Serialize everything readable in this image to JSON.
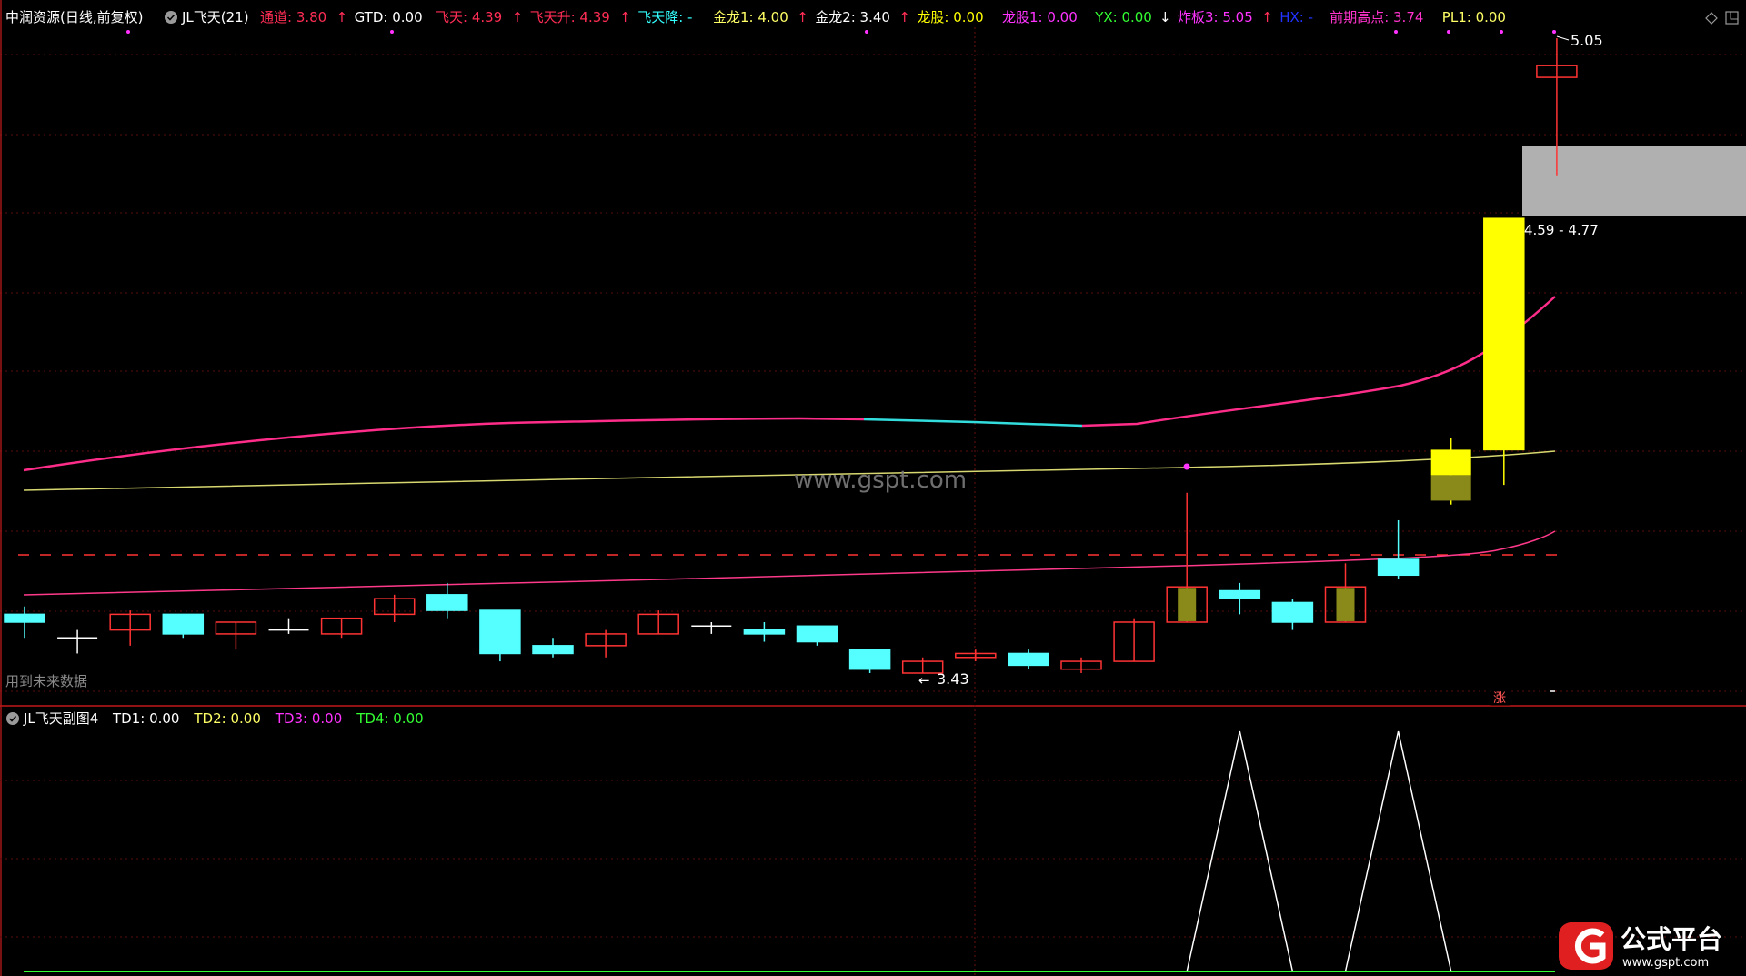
{
  "window": {
    "title": "中润资源(日线,前复权)",
    "indicator_name": "JL飞天(21)"
  },
  "main_legend": [
    {
      "label": "通道",
      "value": "3.80",
      "arrow": "up",
      "color": "#ff2d55"
    },
    {
      "label": "GTD",
      "value": "0.00",
      "arrow": "",
      "color": "#ffffff"
    },
    {
      "label": "飞天",
      "value": "4.39",
      "arrow": "up",
      "color": "#ff2d55"
    },
    {
      "label": "飞天升",
      "value": "4.39",
      "arrow": "up",
      "color": "#ff2d55"
    },
    {
      "label": "飞天降",
      "value": "-",
      "arrow": "",
      "color": "#33ffff"
    },
    {
      "label": "金龙1",
      "value": "4.00",
      "arrow": "up",
      "color": "#ffff66"
    },
    {
      "label": "金龙2",
      "value": "3.40",
      "arrow": "up",
      "color": "#ffffff"
    },
    {
      "label": "龙股",
      "value": "0.00",
      "arrow": "",
      "color": "#ffff00"
    },
    {
      "label": "龙股1",
      "value": "0.00",
      "arrow": "",
      "color": "#ff33ff"
    },
    {
      "label": "YX",
      "value": "0.00",
      "arrow": "down",
      "color": "#33ff33"
    },
    {
      "label": "炸板3",
      "value": "5.05",
      "arrow": "up",
      "color": "#ff33ff"
    },
    {
      "label": "HX",
      "value": "-",
      "arrow": "",
      "color": "#2233ff"
    },
    {
      "label": "前期高点",
      "value": "3.74",
      "arrow": "",
      "color": "#ff33cc"
    },
    {
      "label": "PL1",
      "value": "0.00",
      "arrow": "",
      "color": "#ffff66"
    }
  ],
  "main_chart": {
    "high_label": "5.05",
    "low_label": "3.43",
    "zone_label": "4.59 - 4.77",
    "future_data_note": "用到未来数据",
    "watermark": "www.gspt.com",
    "limit_up_badge": "涨"
  },
  "sub_legend": {
    "name": "JL飞天副图4",
    "items": [
      {
        "label": "TD1",
        "value": "0.00",
        "color": "#ffffff"
      },
      {
        "label": "TD2",
        "value": "0.00",
        "color": "#ffff66"
      },
      {
        "label": "TD3",
        "value": "0.00",
        "color": "#ff33ff"
      },
      {
        "label": "TD4",
        "value": "0.00",
        "color": "#33ff33"
      }
    ]
  },
  "brand": {
    "name": "公式平台",
    "url": "www.gspt.com"
  },
  "colors": {
    "up": "#ff3333",
    "down": "#55ffff",
    "magenta": "#ff2d8a",
    "yellow": "#ffff00",
    "olive": "#8a8a1a",
    "grid": "#7a1010"
  },
  "chart_data": {
    "type": "candlestick",
    "bars": [
      {
        "o": 3.58,
        "h": 3.6,
        "l": 3.52,
        "c": 3.56,
        "fill": "cyan"
      },
      {
        "o": 3.52,
        "h": 3.54,
        "l": 3.48,
        "c": 3.52,
        "fill": "cross"
      },
      {
        "o": 3.54,
        "h": 3.59,
        "l": 3.5,
        "c": 3.58,
        "fill": "red-hollow"
      },
      {
        "o": 3.58,
        "h": 3.58,
        "l": 3.52,
        "c": 3.53,
        "fill": "cyan"
      },
      {
        "o": 3.53,
        "h": 3.56,
        "l": 3.49,
        "c": 3.56,
        "fill": "red-hollow"
      },
      {
        "o": 3.54,
        "h": 3.57,
        "l": 3.53,
        "c": 3.54,
        "fill": "cross"
      },
      {
        "o": 3.53,
        "h": 3.57,
        "l": 3.52,
        "c": 3.57,
        "fill": "red-hollow"
      },
      {
        "o": 3.58,
        "h": 3.63,
        "l": 3.56,
        "c": 3.62,
        "fill": "red-hollow"
      },
      {
        "o": 3.63,
        "h": 3.66,
        "l": 3.57,
        "c": 3.59,
        "fill": "cyan"
      },
      {
        "o": 3.59,
        "h": 3.59,
        "l": 3.46,
        "c": 3.48,
        "fill": "cyan"
      },
      {
        "o": 3.5,
        "h": 3.52,
        "l": 3.47,
        "c": 3.48,
        "fill": "cyan"
      },
      {
        "o": 3.5,
        "h": 3.54,
        "l": 3.47,
        "c": 3.53,
        "fill": "red-hollow"
      },
      {
        "o": 3.53,
        "h": 3.59,
        "l": 3.53,
        "c": 3.58,
        "fill": "red-hollow"
      },
      {
        "o": 3.55,
        "h": 3.56,
        "l": 3.53,
        "c": 3.55,
        "fill": "cross"
      },
      {
        "o": 3.54,
        "h": 3.56,
        "l": 3.51,
        "c": 3.53,
        "fill": "cyan"
      },
      {
        "o": 3.55,
        "h": 3.55,
        "l": 3.5,
        "c": 3.51,
        "fill": "cyan"
      },
      {
        "o": 3.49,
        "h": 3.49,
        "l": 3.43,
        "c": 3.44,
        "fill": "cyan"
      },
      {
        "o": 3.43,
        "h": 3.47,
        "l": 3.43,
        "c": 3.46,
        "fill": "red-hollow"
      },
      {
        "o": 3.47,
        "h": 3.49,
        "l": 3.46,
        "c": 3.48,
        "fill": "red-hollow"
      },
      {
        "o": 3.48,
        "h": 3.49,
        "l": 3.44,
        "c": 3.45,
        "fill": "cyan"
      },
      {
        "o": 3.44,
        "h": 3.47,
        "l": 3.43,
        "c": 3.46,
        "fill": "red-hollow"
      },
      {
        "o": 3.46,
        "h": 3.57,
        "l": 3.46,
        "c": 3.56,
        "fill": "red-hollow"
      },
      {
        "o": 3.56,
        "h": 3.89,
        "l": 3.56,
        "c": 3.65,
        "fill": "olive"
      },
      {
        "o": 3.64,
        "h": 3.66,
        "l": 3.58,
        "c": 3.62,
        "fill": "cyan"
      },
      {
        "o": 3.61,
        "h": 3.62,
        "l": 3.54,
        "c": 3.56,
        "fill": "cyan"
      },
      {
        "o": 3.56,
        "h": 3.71,
        "l": 3.56,
        "c": 3.65,
        "fill": "olive"
      },
      {
        "o": 3.72,
        "h": 3.82,
        "l": 3.67,
        "c": 3.68,
        "fill": "cyan"
      },
      {
        "o": 3.87,
        "h": 4.03,
        "l": 3.86,
        "c": 4.0,
        "fill": "yellow-olive"
      },
      {
        "o": 4.0,
        "h": 4.59,
        "l": 3.91,
        "c": 4.59,
        "fill": "yellow"
      },
      {
        "o": 4.95,
        "h": 5.05,
        "l": 4.7,
        "c": 4.98,
        "fill": "red-hollow"
      }
    ]
  },
  "sub_chart_data": {
    "type": "line",
    "x": [
      22,
      23,
      24,
      25,
      26,
      27
    ],
    "values": [
      0,
      1,
      0,
      0,
      1,
      0
    ]
  }
}
